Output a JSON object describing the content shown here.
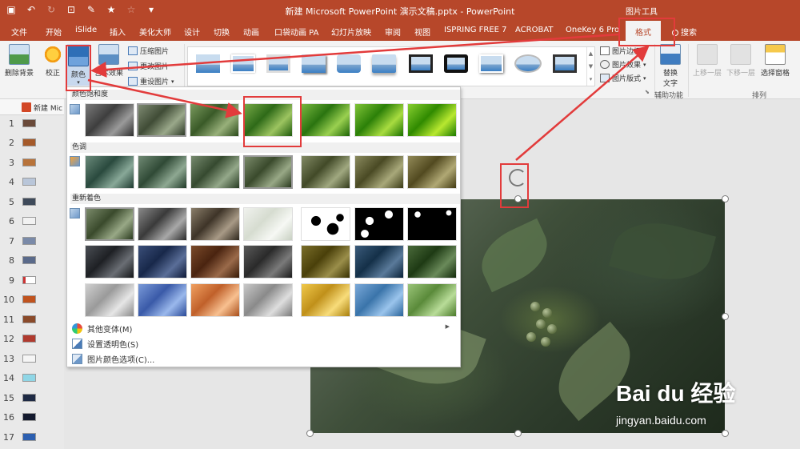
{
  "titlebar": {
    "doc_title": "新建 Microsoft PowerPoint 演示文稿.pptx  -  PowerPoint",
    "tools_label": "图片工具"
  },
  "tabs": [
    {
      "label": "文件"
    },
    {
      "label": "开始"
    },
    {
      "label": "iSlide"
    },
    {
      "label": "插入"
    },
    {
      "label": "美化大师"
    },
    {
      "label": "设计"
    },
    {
      "label": "切换"
    },
    {
      "label": "动画"
    },
    {
      "label": "口袋动画 PA"
    },
    {
      "label": "幻灯片放映"
    },
    {
      "label": "审阅"
    },
    {
      "label": "视图"
    },
    {
      "label": "ISPRING FREE 7"
    },
    {
      "label": "ACROBAT"
    },
    {
      "label": "OneKey 6 Pro"
    },
    {
      "label": "格式",
      "active": true
    },
    {
      "label": "搜索"
    }
  ],
  "ribbon": {
    "remove_bg": "删除背景",
    "corrections": "校正",
    "color": "颜色",
    "art_effects": "艺术效果",
    "compress": "压缩图片",
    "change_pic": "更改图片",
    "reset_pic": "重设图片",
    "border": "图片边框",
    "effects": "图片效果",
    "layout": "图片版式",
    "alt_text_1": "替换",
    "alt_text_2": "文字",
    "accessibility": "辅助功能",
    "bring_forward": "上移一层",
    "send_backward": "下移一层",
    "selection_pane": "选择窗格",
    "arrange": "排列",
    "accent": "#b7472a"
  },
  "sidebar": {
    "tab_name": "新建 Mic",
    "slides": [
      "1",
      "2",
      "3",
      "4",
      "5",
      "6",
      "7",
      "8",
      "9",
      "10",
      "11",
      "12",
      "13",
      "14",
      "15",
      "16",
      "17"
    ]
  },
  "dropdown": {
    "saturation_label": "颜色饱和度",
    "tone_label": "色调",
    "recolor_label": "重新着色",
    "more_variants": "其他变体(M)",
    "set_transparent": "设置透明色(S)",
    "color_options": "图片颜色选项(C)..."
  },
  "watermark": {
    "brand": "Bai du 经验",
    "url": "jingyan.baidu.com"
  }
}
